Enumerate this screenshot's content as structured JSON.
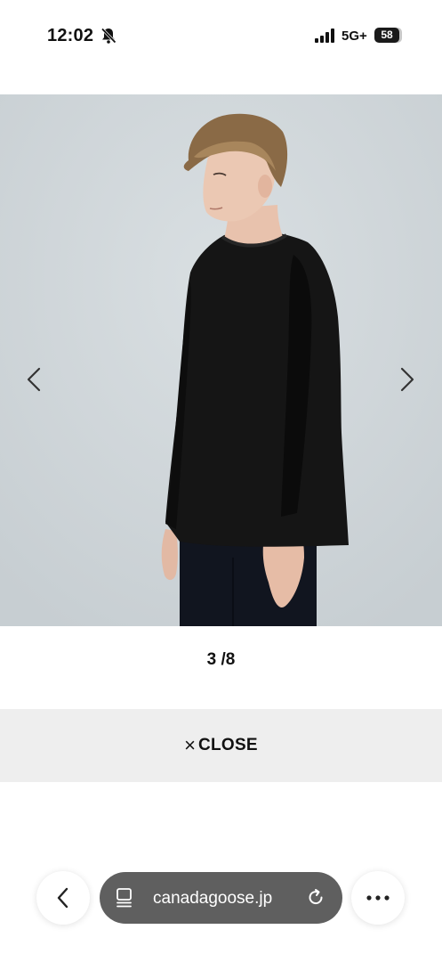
{
  "status_bar": {
    "time": "12:02",
    "network": "5G+",
    "battery": "58"
  },
  "viewer": {
    "counter": "3 /8",
    "prev_icon": "chevron-left-icon",
    "next_icon": "chevron-right-icon",
    "background_color": "#cfd6da"
  },
  "close_bar": {
    "icon": "×",
    "label": "CLOSE"
  },
  "browser": {
    "url": "canadagoose.jp",
    "back_icon": "chevron-left-icon",
    "more_icon": "more-icon",
    "page_icon": "page-icon",
    "reload_icon": "reload-icon"
  }
}
